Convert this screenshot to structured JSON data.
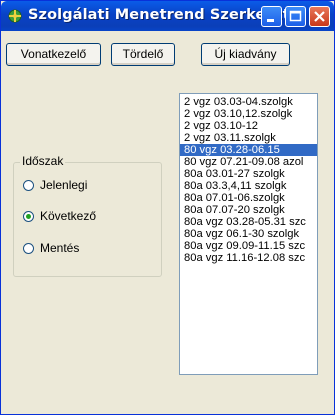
{
  "window": {
    "title": "Szolgálati Menetrend Szerkesztő",
    "accent": "#0a5ce8"
  },
  "toolbar": {
    "vonatkezelo_label": "Vonatkezelő",
    "tordelo_label": "Tördelő",
    "uj_kiadvany_label": "Új kiadvány"
  },
  "period_group": {
    "label": "Időszak",
    "options": [
      {
        "label": "Jelenlegi",
        "checked": false
      },
      {
        "label": "Következő",
        "checked": true
      },
      {
        "label": "Mentés",
        "checked": false
      }
    ]
  },
  "schedule_list": {
    "selected_index": 4,
    "items": [
      "2 vgz 03.03-04.szolgk",
      "2 vgz 03.10,12.szolgk",
      "2 vgz 03.10-12",
      "2 vgz 03.11.szolgk",
      "80 vgz 03.28-06.15",
      "80 vgz 07.21-09.08 azol",
      "80a 03.01-27 szolgk",
      "80a 03.3,4,11 szolgk",
      "80a 07.01-06.szolgk",
      "80a 07.07-20 szolgk",
      "80a vgz 03.28-05.31 szc",
      "80a vgz 06.1-30 szolgk",
      "80a vgz 09.09-11.15 szc",
      "80a vgz 11.16-12.08 szc"
    ]
  }
}
